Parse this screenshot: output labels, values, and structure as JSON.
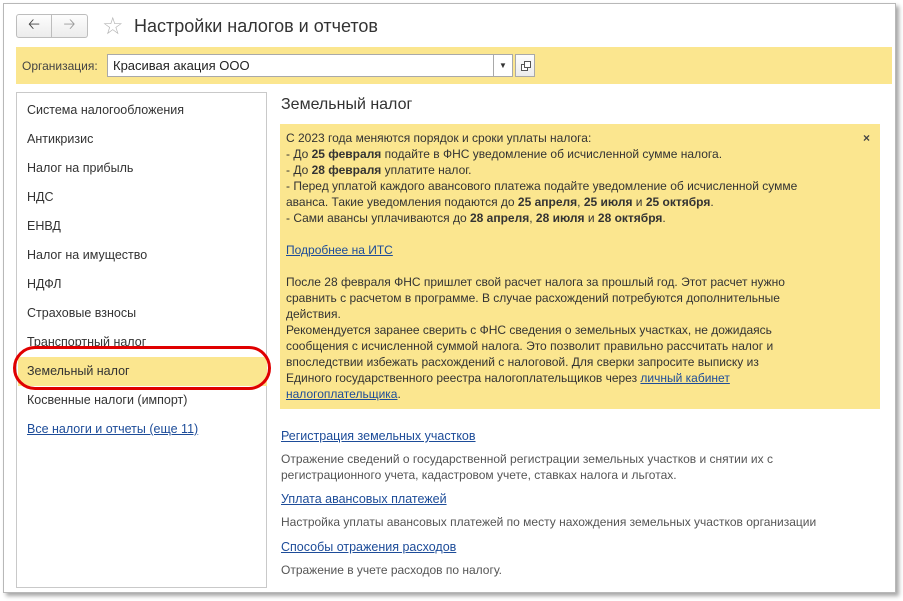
{
  "window": {
    "title": "Настройки налогов и отчетов",
    "back_icon": "arrow-left-icon",
    "forward_icon": "arrow-right-icon",
    "favorite_icon": "star-icon"
  },
  "organization": {
    "label": "Организация:",
    "value": "Красивая акация ООО"
  },
  "sidebar": {
    "items": [
      {
        "label": "Система налогообложения"
      },
      {
        "label": "Антикризис"
      },
      {
        "label": "Налог на прибыль"
      },
      {
        "label": "НДС"
      },
      {
        "label": "ЕНВД"
      },
      {
        "label": "Налог на имущество"
      },
      {
        "label": "НДФЛ"
      },
      {
        "label": "Страховые взносы"
      },
      {
        "label": "Транспортный налог"
      },
      {
        "label": "Земельный налог"
      },
      {
        "label": "Косвенные налоги (импорт)"
      },
      {
        "label": "Все налоги и отчеты (еще 11)"
      }
    ],
    "active_index": 9
  },
  "content": {
    "title": "Земельный налог",
    "info": {
      "close": "×",
      "intro": "С 2023 года меняются порядок и сроки уплаты налога:",
      "l1_a": " - До ",
      "l1_b": "25 февраля",
      "l1_c": " подайте в ФНС уведомление об исчисленной сумме налога.",
      "l2_a": " - До ",
      "l2_b": "28 февраля",
      "l2_c": " уплатите налог.",
      "l3": " - Перед уплатой каждого авансового платежа подайте уведомление об исчисленной сумме",
      "l4_a": "аванса. Такие уведомления подаются до ",
      "l4_b": "25 апреля",
      "l4_c": ", ",
      "l4_d": "25 июля",
      "l4_e": " и ",
      "l4_f": "25 октября",
      "l4_g": ".",
      "l5_a": " - Сами авансы уплачиваются до ",
      "l5_b": "28 апреля",
      "l5_c": ", ",
      "l5_d": "28 июля",
      "l5_e": " и ",
      "l5_f": "28 октября",
      "l5_g": ".",
      "its_link": "Подробнее на ИТС",
      "p2_1": "После 28 февраля ФНС пришлет свой расчет налога за прошлый год. Этот расчет нужно",
      "p2_2": "сравнить с расчетом в программе. В случае расхождений потребуются дополнительные",
      "p2_3": "действия.",
      "p3_1": "Рекомендуется заранее сверить с ФНС сведения о земельных участках, не дожидаясь",
      "p3_2": "сообщения с исчисленной суммой налога. Это позволит правильно рассчитать налог и",
      "p3_3": "впоследствии избежать расхождений с налоговой. Для сверки запросите выписку из",
      "p3_4_a": "Единого государственного реестра налогоплательщиков через ",
      "p3_4_link": "личный кабинет",
      "p3_5_link": "налогоплательщика",
      "p3_5_b": "."
    },
    "sections": [
      {
        "link": "Регистрация земельных участков",
        "desc1": "Отражение сведений о государственной регистрации земельных участков и снятии их с",
        "desc2": "регистрационного учета, кадастровом учете, ставках налога и льготах."
      },
      {
        "link": "Уплата авансовых платежей",
        "desc1": "Настройка уплаты авансовых платежей по месту нахождения земельных участков организации",
        "desc2": ""
      },
      {
        "link": "Способы отражения расходов",
        "desc1": "Отражение в учете расходов по налогу.",
        "desc2": ""
      }
    ]
  },
  "colors": {
    "accent_yellow": "#fbe68f",
    "link_blue": "#1d4c99",
    "highlight_red": "#e00000"
  }
}
